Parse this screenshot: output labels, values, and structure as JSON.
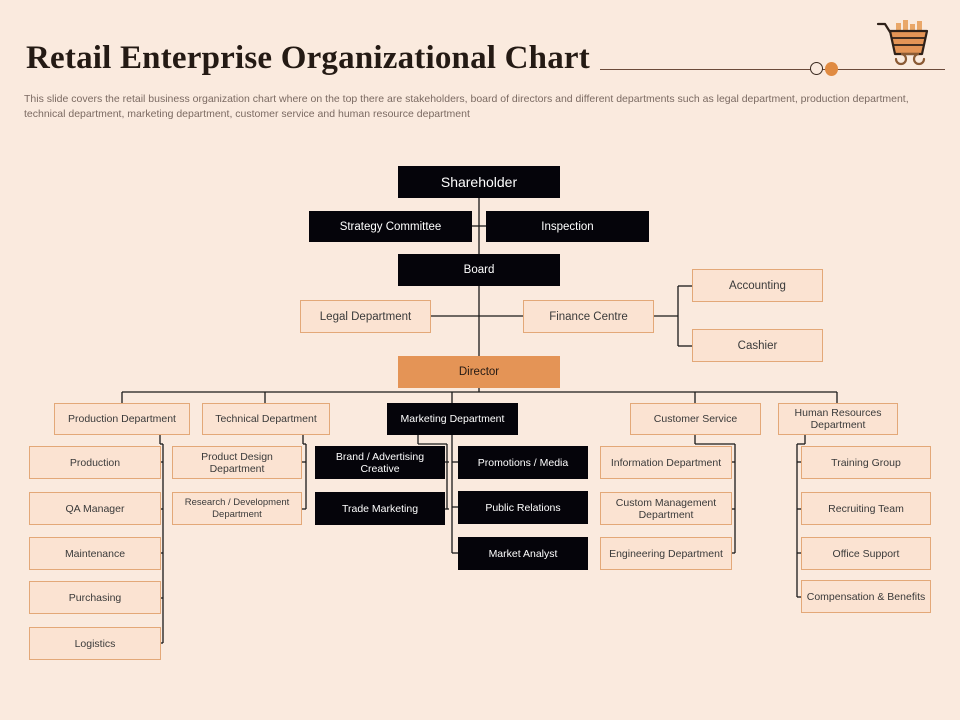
{
  "header": {
    "title": "Retail Enterprise Organizational Chart",
    "subtitle": "This slide covers the retail business organization chart where on the top there are stakeholders, board of directors and different departments such as legal department, production department, technical department, marketing department, customer service and human resource department",
    "icons": {
      "cart": "shopping-cart-icon",
      "circle": "outline-circle-marker",
      "dot": "filled-dot-marker"
    }
  },
  "colors": {
    "background": "#faeade",
    "dark_box": "#05040a",
    "dark_text": "#ffffff",
    "light_box_fill": "#fbe3d2",
    "light_box_border": "#e3a878",
    "accent_box": "#e49456",
    "title_text": "#241a14",
    "subtitle_text": "#7b6a62",
    "connector": "#1a1a1a"
  },
  "chart_data": {
    "type": "diagram",
    "title": "Retail Enterprise Organizational Chart",
    "nodes": {
      "shareholder": "Shareholder",
      "strategy_committee": "Strategy Committee",
      "inspection": "Inspection",
      "board": "Board",
      "legal_department": "Legal Department",
      "finance_centre": "Finance Centre",
      "accounting": "Accounting",
      "cashier": "Cashier",
      "director": "Director",
      "production_department": "Production Department",
      "technical_department": "Technical Department",
      "marketing_department": "Marketing Department",
      "customer_service": "Customer Service",
      "human_resources_department": "Human Resources Department",
      "production": "Production",
      "qa_manager": "QA Manager",
      "maintenance": "Maintenance",
      "purchasing": "Purchasing",
      "logistics": "Logistics",
      "product_design_department": "Product Design Department",
      "research_development_department": "Research / Development Department",
      "brand_advertising_creative": "Brand / Advertising Creative",
      "trade_marketing": "Trade Marketing",
      "promotions_media": "Promotions / Media",
      "public_relations": "Public Relations",
      "market_analyst": "Market Analyst",
      "information_department": "Information Department",
      "custom_management_department": "Custom Management Department",
      "engineering_department": "Engineering Department",
      "training_group": "Training Group",
      "recruiting_team": "Recruiting Team",
      "office_support": "Office Support",
      "compensation_benefits": "Compensation & Benefits"
    },
    "levels": [
      [
        "Shareholder"
      ],
      [
        "Strategy Committee",
        "Inspection"
      ],
      [
        "Board"
      ],
      [
        "Legal Department",
        "Finance Centre"
      ],
      [
        "Director"
      ],
      [
        "Production Department",
        "Technical Department",
        "Marketing Department",
        "Customer Service",
        "Human Resources Department"
      ]
    ],
    "edges": [
      [
        "Shareholder",
        "Board"
      ],
      [
        "Shareholder",
        "Strategy Committee"
      ],
      [
        "Shareholder",
        "Inspection"
      ],
      [
        "Board",
        "Legal Department"
      ],
      [
        "Board",
        "Finance Centre"
      ],
      [
        "Board",
        "Director"
      ],
      [
        "Finance Centre",
        "Accounting"
      ],
      [
        "Finance Centre",
        "Cashier"
      ],
      [
        "Director",
        "Production Department"
      ],
      [
        "Director",
        "Technical Department"
      ],
      [
        "Director",
        "Marketing Department"
      ],
      [
        "Director",
        "Customer Service"
      ],
      [
        "Director",
        "Human Resources Department"
      ],
      [
        "Production Department",
        "Production"
      ],
      [
        "Production Department",
        "QA Manager"
      ],
      [
        "Production Department",
        "Maintenance"
      ],
      [
        "Production Department",
        "Purchasing"
      ],
      [
        "Production Department",
        "Logistics"
      ],
      [
        "Technical Department",
        "Product Design Department"
      ],
      [
        "Technical Department",
        "Research / Development Department"
      ],
      [
        "Marketing Department",
        "Brand / Advertising Creative"
      ],
      [
        "Marketing Department",
        "Trade Marketing"
      ],
      [
        "Marketing Department",
        "Promotions / Media"
      ],
      [
        "Marketing Department",
        "Public Relations"
      ],
      [
        "Marketing Department",
        "Market Analyst"
      ],
      [
        "Customer Service",
        "Information Department"
      ],
      [
        "Customer Service",
        "Custom Management Department"
      ],
      [
        "Customer Service",
        "Engineering Department"
      ],
      [
        "Human Resources Department",
        "Training Group"
      ],
      [
        "Human Resources Department",
        "Recruiting Team"
      ],
      [
        "Human Resources Department",
        "Office Support"
      ],
      [
        "Human Resources Department",
        "Compensation & Benefits"
      ]
    ]
  }
}
